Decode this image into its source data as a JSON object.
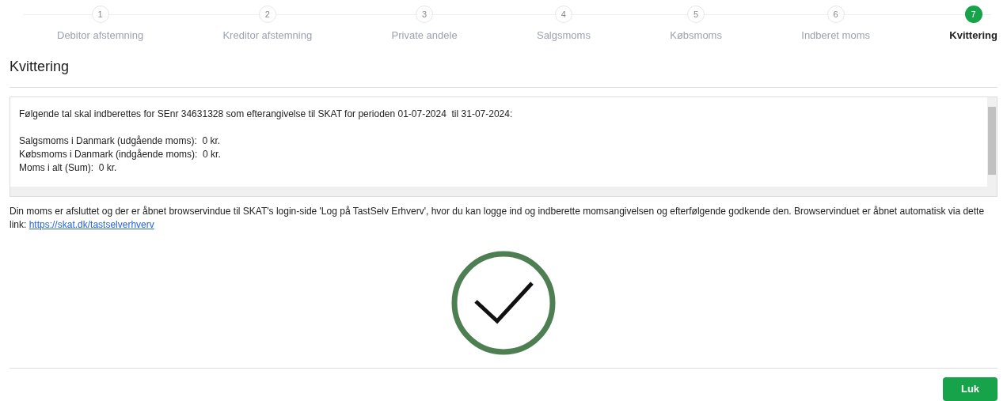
{
  "steps": [
    {
      "number": "1",
      "label": "Debitor afstemning",
      "selected": false
    },
    {
      "number": "2",
      "label": "Kreditor afstemning",
      "selected": false
    },
    {
      "number": "3",
      "label": "Private andele",
      "selected": false
    },
    {
      "number": "4",
      "label": "Salgsmoms",
      "selected": false
    },
    {
      "number": "5",
      "label": "Købsmoms",
      "selected": false
    },
    {
      "number": "6",
      "label": "Indberet moms",
      "selected": false
    },
    {
      "number": "7",
      "label": "Kvittering",
      "selected": true
    }
  ],
  "title": "Kvittering",
  "report": {
    "heading": "Følgende tal skal indberettes for SEnr 34631328 som efterangivelse til SKAT for perioden 01-07-2024  til 31-07-2024:",
    "lines": [
      "Salgsmoms i Danmark (udgående moms):  0 kr.",
      "Købsmoms i Danmark (indgående moms):  0 kr.",
      "Moms i alt (Sum):  0 kr."
    ]
  },
  "message": {
    "text": "Din moms er afsluttet og der er åbnet browservindue til SKAT's login-side 'Log på TastSelv Erhverv', hvor du kan logge ind og indberette momsangivelsen og efterfølgende godkende den. Browservinduet er åbnet automatisk via dette link: ",
    "link": "https://skat.dk/tastselverhverv"
  },
  "close_button": "Luk"
}
